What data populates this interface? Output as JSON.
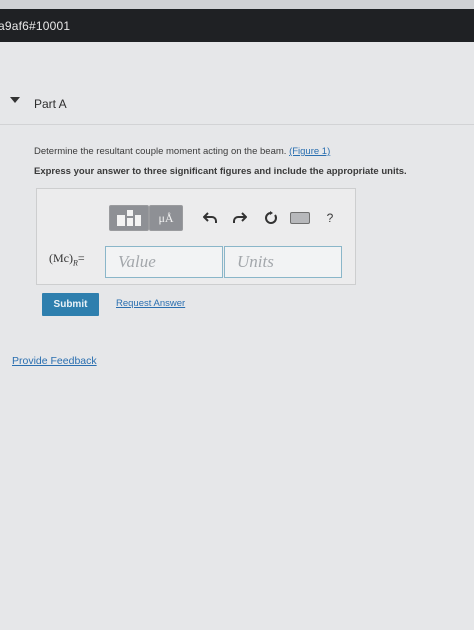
{
  "header": {
    "title": "a9af6#10001"
  },
  "part": {
    "title": "Part A"
  },
  "question": {
    "text": "Determine the resultant couple moment acting on the beam.",
    "figure_link": "(Figure 1)"
  },
  "instruction": "Express your answer to three significant figures and include the appropriate units.",
  "toolbar": {
    "units_label": "μÅ",
    "help_label": "?"
  },
  "answer": {
    "variable": "(Mc)",
    "variable_sub": "R",
    "equals": "=",
    "value_placeholder": "Value",
    "units_placeholder": "Units"
  },
  "actions": {
    "submit_label": "Submit",
    "request_label": "Request Answer"
  },
  "feedback": {
    "label": "Provide Feedback"
  },
  "colors": {
    "header_bg": "#1f2124",
    "submit_bg": "#2e7fae",
    "link": "#2a6fb0",
    "page_bg": "#e6e7e9"
  }
}
